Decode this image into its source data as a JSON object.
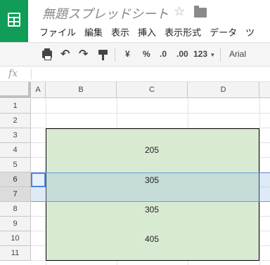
{
  "header": {
    "title": "無題スプレッドシート",
    "menu": [
      "ファイル",
      "編集",
      "表示",
      "挿入",
      "表示形式",
      "データ",
      "ツ"
    ]
  },
  "toolbar": {
    "currency": "¥",
    "percent": "%",
    "dec_less": ".0",
    "dec_more": ".00",
    "format_123": "123",
    "font": "Arial"
  },
  "formula_bar": {
    "fx_label": "fx"
  },
  "sheet": {
    "columns": [
      "A",
      "B",
      "C",
      "D"
    ],
    "rows": [
      "1",
      "2",
      "3",
      "4",
      "5",
      "6",
      "7",
      "8",
      "9",
      "10",
      "11"
    ],
    "values": [
      "205",
      "305",
      "305",
      "405"
    ]
  },
  "colors": {
    "brand": "#0f9d58",
    "range_fill": "#d9ead3",
    "selection": "#4a86e8"
  }
}
